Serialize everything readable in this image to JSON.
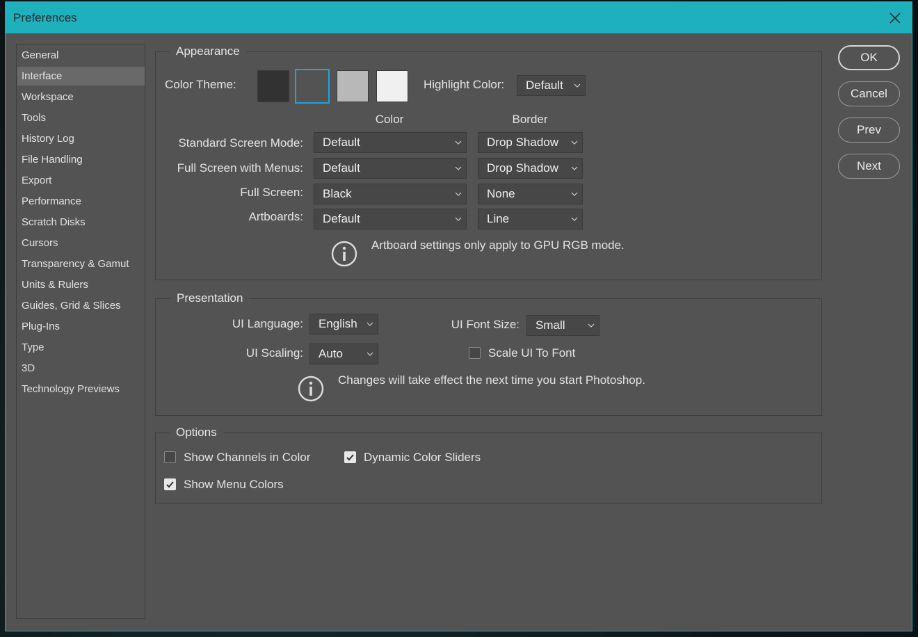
{
  "window": {
    "title": "Preferences"
  },
  "sidebar": {
    "items": [
      {
        "label": "General",
        "active": false
      },
      {
        "label": "Interface",
        "active": true
      },
      {
        "label": "Workspace",
        "active": false
      },
      {
        "label": "Tools",
        "active": false
      },
      {
        "label": "History Log",
        "active": false
      },
      {
        "label": "File Handling",
        "active": false
      },
      {
        "label": "Export",
        "active": false
      },
      {
        "label": "Performance",
        "active": false
      },
      {
        "label": "Scratch Disks",
        "active": false
      },
      {
        "label": "Cursors",
        "active": false
      },
      {
        "label": "Transparency & Gamut",
        "active": false
      },
      {
        "label": "Units & Rulers",
        "active": false
      },
      {
        "label": "Guides, Grid & Slices",
        "active": false
      },
      {
        "label": "Plug-Ins",
        "active": false
      },
      {
        "label": "Type",
        "active": false
      },
      {
        "label": "3D",
        "active": false
      },
      {
        "label": "Technology Previews",
        "active": false
      }
    ]
  },
  "appearance": {
    "legend": "Appearance",
    "color_theme_label": "Color Theme:",
    "themes": [
      {
        "name": "darkest",
        "color": "#323232",
        "selected": false
      },
      {
        "name": "dark",
        "color": "#535353",
        "selected": true
      },
      {
        "name": "light",
        "color": "#b8b8b8",
        "selected": false
      },
      {
        "name": "lightest",
        "color": "#f0f0f0",
        "selected": false
      }
    ],
    "selection_color": "#1ea4dc",
    "highlight_label": "Highlight Color:",
    "highlight_value": "Default",
    "col_color": "Color",
    "col_border": "Border",
    "rows": [
      {
        "label": "Standard Screen Mode:",
        "color": "Default",
        "border": "Drop Shadow"
      },
      {
        "label": "Full Screen with Menus:",
        "color": "Default",
        "border": "Drop Shadow"
      },
      {
        "label": "Full Screen:",
        "color": "Black",
        "border": "None"
      },
      {
        "label": "Artboards:",
        "color": "Default",
        "border": "Line"
      }
    ],
    "info": "Artboard settings only apply to GPU RGB mode."
  },
  "presentation": {
    "legend": "Presentation",
    "ui_language_label": "UI Language:",
    "ui_language_value": "English",
    "ui_font_size_label": "UI Font Size:",
    "ui_font_size_value": "Small",
    "ui_scaling_label": "UI Scaling:",
    "ui_scaling_value": "Auto",
    "scale_ui_to_font_label": "Scale UI To Font",
    "scale_ui_to_font_checked": false,
    "info": "Changes will take effect the next time you start Photoshop."
  },
  "options": {
    "legend": "Options",
    "show_channels_label": "Show Channels in Color",
    "show_channels_checked": false,
    "dynamic_sliders_label": "Dynamic Color Sliders",
    "dynamic_sliders_checked": true,
    "show_menu_colors_label": "Show Menu Colors",
    "show_menu_colors_checked": true
  },
  "buttons": {
    "ok": "OK",
    "cancel": "Cancel",
    "prev": "Prev",
    "next": "Next"
  },
  "colors": {
    "titlebar": "#1fb0bd",
    "panel": "#535353"
  }
}
